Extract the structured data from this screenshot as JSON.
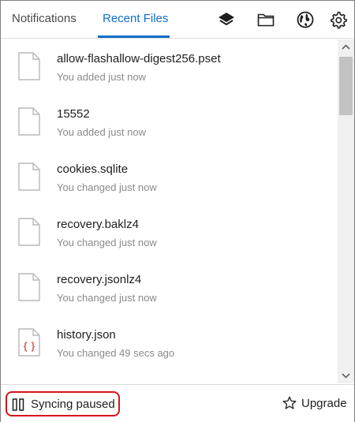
{
  "header": {
    "tabs": [
      {
        "label": "Notifications",
        "active": false
      },
      {
        "label": "Recent Files",
        "active": true
      }
    ],
    "icons": [
      "layers-icon",
      "folder-icon",
      "globe-icon",
      "gear-icon"
    ]
  },
  "files": [
    {
      "name": "allow-flashallow-digest256.pset",
      "status": "You added just now",
      "icon": "file-icon"
    },
    {
      "name": "15552",
      "status": "You added just now",
      "icon": "file-icon"
    },
    {
      "name": "cookies.sqlite",
      "status": "You changed just now",
      "icon": "file-icon"
    },
    {
      "name": "recovery.baklz4",
      "status": "You changed just now",
      "icon": "file-icon"
    },
    {
      "name": "recovery.jsonlz4",
      "status": "You changed just now",
      "icon": "file-icon"
    },
    {
      "name": "history.json",
      "status": "You changed 49 secs ago",
      "icon": "json-file-icon"
    }
  ],
  "footer": {
    "sync_label": "Syncing paused",
    "upgrade_label": "Upgrade"
  },
  "colors": {
    "accent": "#0f6ec9",
    "highlight": "#d4151c",
    "json_icon": "#d9534f"
  }
}
